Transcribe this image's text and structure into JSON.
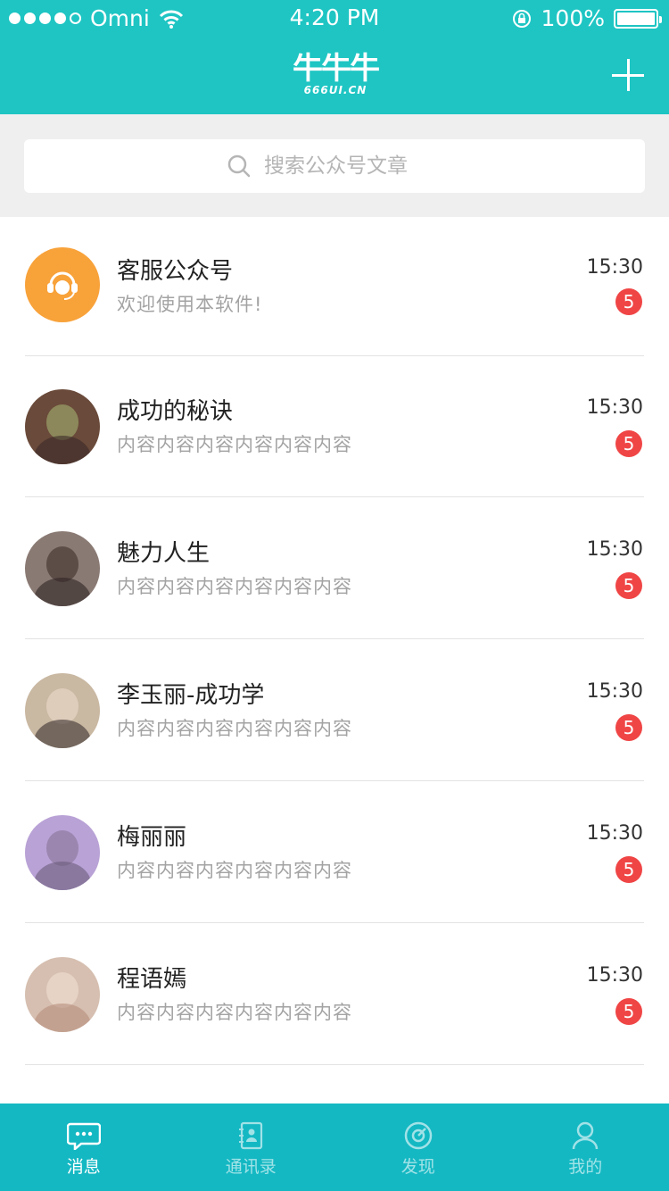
{
  "status_bar": {
    "carrier": "Omni",
    "time": "4:20 PM",
    "battery": "100%"
  },
  "header": {
    "logo_mark": "牛牛牛",
    "logo_text": "666UI.CN",
    "add_icon": "plus-icon"
  },
  "search": {
    "placeholder": "搜索公众号文章",
    "icon": "search-icon"
  },
  "conversations": [
    {
      "name": "客服公众号",
      "preview": "欢迎使用本软件!",
      "time": "15:30",
      "unread": "5",
      "avatar_color": "#f8a23a"
    },
    {
      "name": "成功的秘诀",
      "preview": "内容内容内容内容内容内容",
      "time": "15:30",
      "unread": "5",
      "avatar_color": "#6a4a3a"
    },
    {
      "name": "魅力人生",
      "preview": "内容内容内容内容内容内容",
      "time": "15:30",
      "unread": "5",
      "avatar_color": "#4a3a34"
    },
    {
      "name": "李玉丽-成功学",
      "preview": "内容内容内容内容内容内容",
      "time": "15:30",
      "unread": "5",
      "avatar_color": "#c9b8a2"
    },
    {
      "name": "梅丽丽",
      "preview": "内容内容内容内容内容内容",
      "time": "15:30",
      "unread": "5",
      "avatar_color": "#b9a2d6"
    },
    {
      "name": "程语嫣",
      "preview": "内容内容内容内容内容内容",
      "time": "15:30",
      "unread": "5",
      "avatar_color": "#b58e7c"
    }
  ],
  "tabbar": {
    "tabs": [
      {
        "label": "消息",
        "icon": "message-icon",
        "active": true
      },
      {
        "label": "通讯录",
        "icon": "contacts-icon",
        "active": false
      },
      {
        "label": "发现",
        "icon": "discover-icon",
        "active": false
      },
      {
        "label": "我的",
        "icon": "profile-icon",
        "active": false
      }
    ]
  },
  "colors": {
    "header": "#1ec5c3",
    "tabbar": "#14b8c3",
    "badge": "#f04545"
  }
}
